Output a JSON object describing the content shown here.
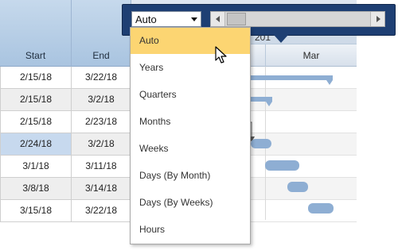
{
  "grid": {
    "columns": {
      "start": "Start",
      "end": "End"
    },
    "rows": [
      {
        "start": "2/15/18",
        "end": "3/22/18"
      },
      {
        "start": "2/15/18",
        "end": "3/2/18"
      },
      {
        "start": "2/15/18",
        "end": "2/23/18"
      },
      {
        "start": "2/24/18",
        "end": "3/2/18",
        "selected": true
      },
      {
        "start": "3/1/18",
        "end": "3/11/18"
      },
      {
        "start": "3/8/18",
        "end": "3/14/18"
      },
      {
        "start": "3/15/18",
        "end": "3/22/18"
      }
    ]
  },
  "timeline": {
    "year_label_partial": "201",
    "month_label": "Mar"
  },
  "toolbar": {
    "zoom_select_value": "Auto",
    "icons": {
      "dropdown": "chevron-down-icon",
      "scroll_left": "arrow-left-icon",
      "scroll_right": "arrow-right-icon",
      "cursor": "mouse-pointer-icon"
    }
  },
  "zoom_menu": {
    "options": [
      "Auto",
      "Years",
      "Quarters",
      "Months",
      "Weeks",
      "Days (By Month)",
      "Days (By Weeks)",
      "Hours"
    ],
    "selected_index": 0
  },
  "colors": {
    "header_blue": "#a9c4e0",
    "toolbar_navy": "#1e3f73",
    "bar": "#8eaed3",
    "selected_option": "#fcd572",
    "selected_cell": "#c7d9ee"
  }
}
